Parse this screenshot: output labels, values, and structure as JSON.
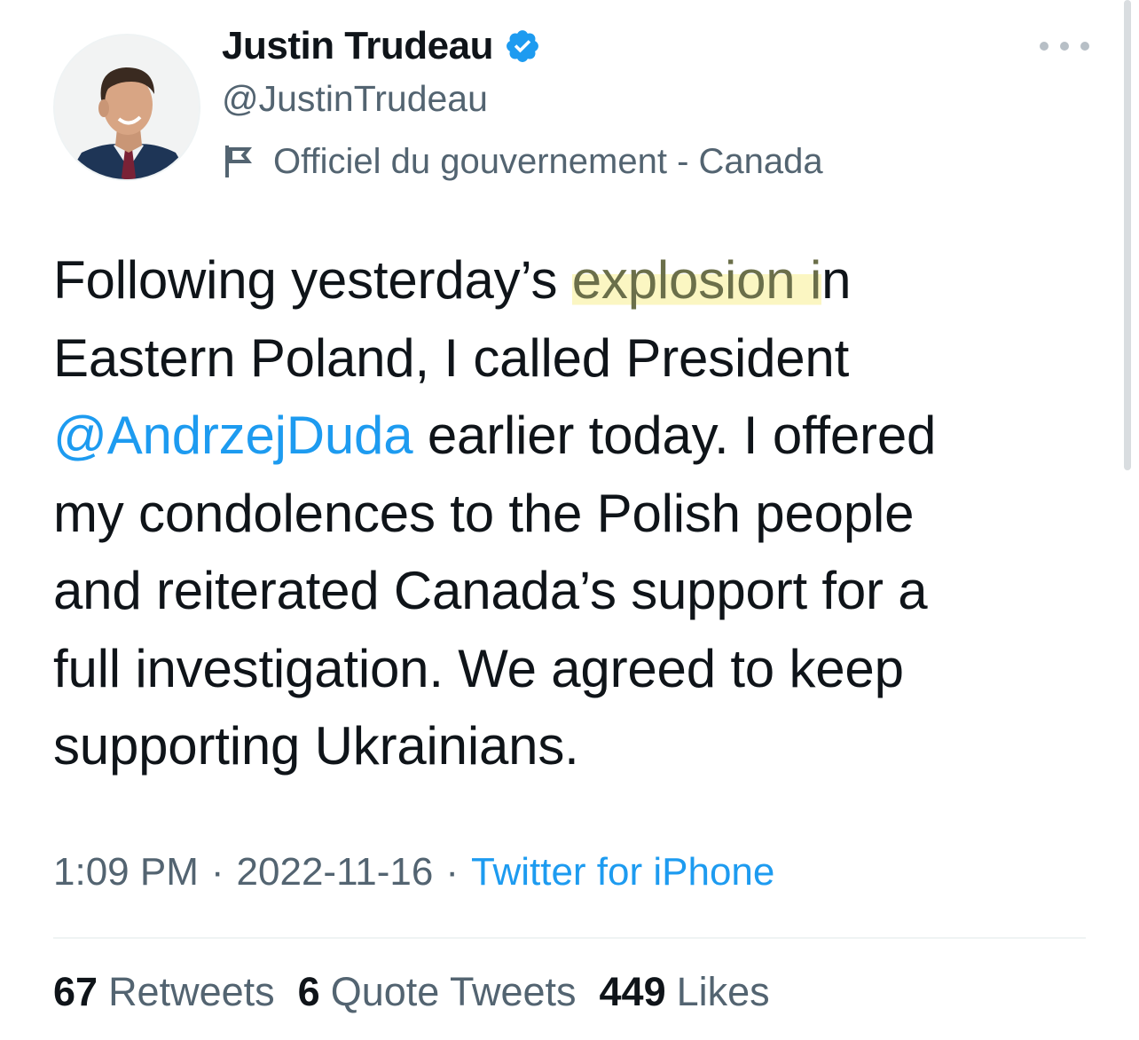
{
  "author": {
    "name": "Justin Trudeau",
    "handle": "@JustinTrudeau",
    "verified": true,
    "label": "Officiel du gouvernement - Canada",
    "label_icon": "flag-icon",
    "avatar_icon": "profile-photo"
  },
  "tweet": {
    "lines": [
      {
        "pre": "Following yesterday’s ",
        "highlight": "explosion i",
        "post": "n"
      },
      {
        "text": "Eastern Poland, I called President"
      },
      {
        "mention": "@AndrzejDuda",
        "text": " earlier today. I offered"
      },
      {
        "text": "my condolences to the Polish people"
      },
      {
        "text": "and reiterated Canada’s support for a"
      },
      {
        "text": "full investigation. We agreed to keep"
      },
      {
        "text": "supporting Ukrainians."
      }
    ]
  },
  "meta": {
    "time": "1:09 PM",
    "date": "2022-11-16",
    "separator": "·",
    "source": "Twitter for iPhone"
  },
  "stats": {
    "retweets": {
      "count": "67",
      "label": "Retweets"
    },
    "quote_tweets": {
      "count": "6",
      "label": "Quote Tweets"
    },
    "likes": {
      "count": "449",
      "label": "Likes"
    }
  },
  "colors": {
    "accent": "#1d9bf0",
    "secondary_text": "#536471",
    "highlight": "#fbf6c2"
  }
}
